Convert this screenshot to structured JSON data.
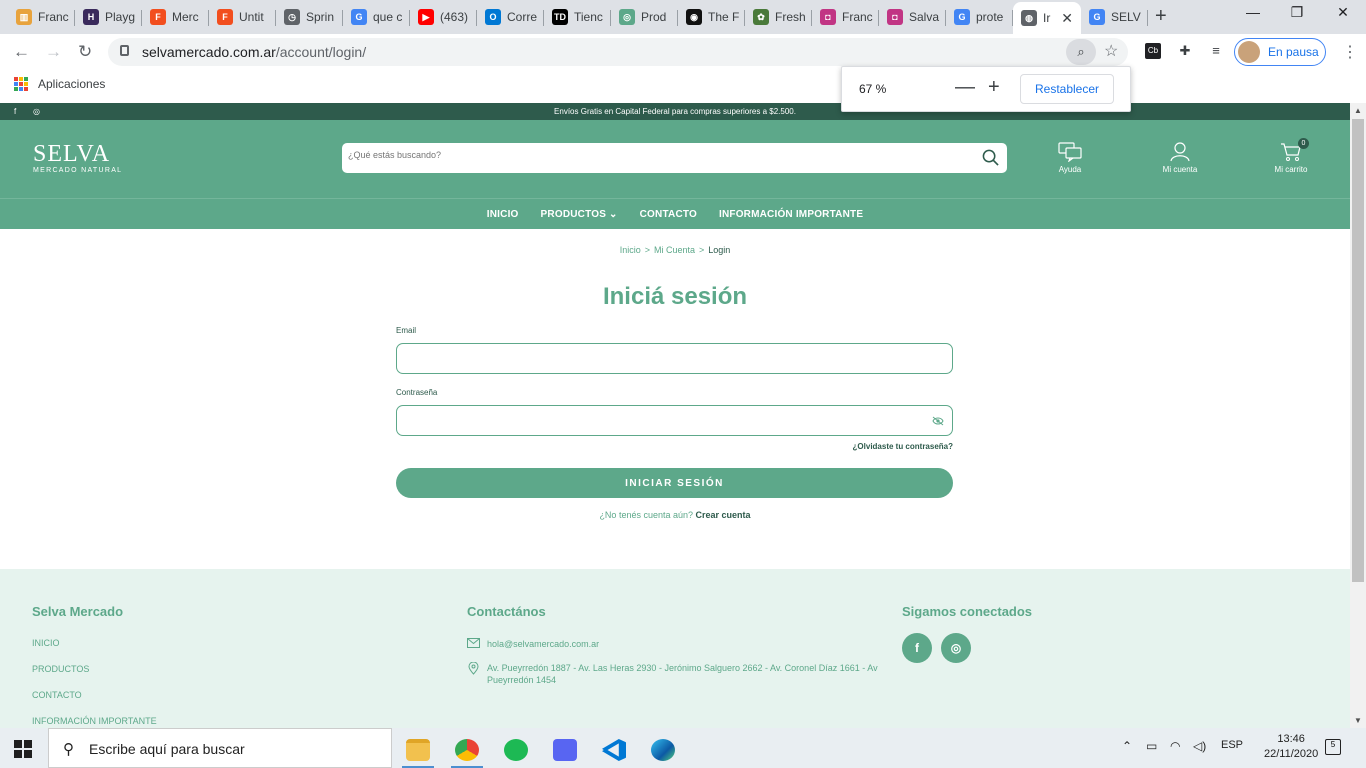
{
  "browser": {
    "tabs": [
      {
        "title": "Franc",
        "color": "#e8a33d",
        "glyph": "▥"
      },
      {
        "title": "Playg",
        "color": "#3a2a5c",
        "glyph": "H"
      },
      {
        "title": "Merc",
        "color": "#f24e1e",
        "glyph": "F"
      },
      {
        "title": "Untit",
        "color": "#f24e1e",
        "glyph": "F"
      },
      {
        "title": "Sprin",
        "color": "#5f6368",
        "glyph": "◷"
      },
      {
        "title": "que c",
        "color": "#4285f4",
        "glyph": "G"
      },
      {
        "title": "(463)",
        "color": "#ff0000",
        "glyph": "▶"
      },
      {
        "title": "Corre",
        "color": "#0078d4",
        "glyph": "O"
      },
      {
        "title": "Tienc",
        "color": "#000000",
        "glyph": "TD"
      },
      {
        "title": "Prod",
        "color": "#5da88a",
        "glyph": "◎"
      },
      {
        "title": "The F",
        "color": "#111111",
        "glyph": "◉"
      },
      {
        "title": "Fresh",
        "color": "#4a7a3a",
        "glyph": "✿"
      },
      {
        "title": "Franc",
        "color": "#c13584",
        "glyph": "◘"
      },
      {
        "title": "Salva",
        "color": "#c13584",
        "glyph": "◘"
      },
      {
        "title": "prote",
        "color": "#4285f4",
        "glyph": "G"
      },
      {
        "title": "Ir",
        "color": "#5f6368",
        "glyph": "◍",
        "active": true
      },
      {
        "title": "SELV",
        "color": "#4285f4",
        "glyph": "G"
      }
    ],
    "url_domain": "selvamercado.com.ar",
    "url_path": "/account/login/",
    "bookmark_apps_label": "Aplicaciones",
    "profile_label": "En pausa",
    "zoom": {
      "level": "67 %",
      "minus": "—",
      "plus": "+",
      "reset_label": "Restablecer"
    }
  },
  "site": {
    "top_banner": "Envíos Gratis en Capital Federal para compras superiores a $2.500.",
    "social_facebook": "f",
    "social_instagram": "◎",
    "logo_main": "SELVA",
    "logo_sub": "MERCADO NATURAL",
    "search_placeholder": "¿Qué estás buscando?",
    "header_icons": {
      "help": "Ayuda",
      "account": "Mi cuenta",
      "cart": "Mi carrito",
      "cart_count": "0"
    },
    "nav": {
      "home": "INICIO",
      "products": "PRODUCTOS",
      "contact": "CONTACTO",
      "info": "INFORMACIÓN IMPORTANTE"
    },
    "breadcrumb": {
      "home": "Inicio",
      "sep": ">",
      "account": "Mi Cuenta",
      "current": "Login"
    },
    "login": {
      "title": "Iniciá sesión",
      "email_label": "Email",
      "password_label": "Contraseña",
      "forgot_label": "¿Olvidaste tu contraseña?",
      "submit_label": "INICIAR SESIÓN",
      "no_account_text": "¿No tenés cuenta aún?",
      "create_account_label": "Crear cuenta"
    },
    "footer": {
      "col1_title": "Selva Mercado",
      "col1_links": [
        "INICIO",
        "PRODUCTOS",
        "CONTACTO",
        "INFORMACIÓN IMPORTANTE"
      ],
      "col2_title": "Contactános",
      "email": "hola@selvamercado.com.ar",
      "address": "Av. Pueyrredón 1887 - Av. Las Heras 2930 - Jerónimo Salguero 2662 - Av. Coronel Díaz 1661 - Av Pueyrredón 1454",
      "col3_title": "Sigamos conectados"
    }
  },
  "taskbar": {
    "search_placeholder": "Escribe aquí para buscar",
    "language": "ESP",
    "time": "13:46",
    "date": "22/11/2020",
    "notification_count": "5"
  }
}
